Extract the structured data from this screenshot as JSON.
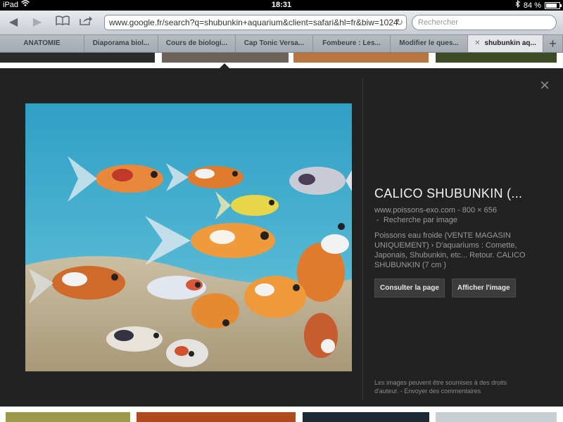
{
  "status": {
    "device": "iPad",
    "time": "18:31",
    "battery": "84 %",
    "battery_level": 0.84
  },
  "toolbar": {
    "url": "www.google.fr/search?q=shubunkin+aquarium&client=safari&hl=fr&biw=1024",
    "search_placeholder": "Rechercher"
  },
  "tabs": [
    {
      "label": "ANATOMIE"
    },
    {
      "label": "Diaporama biol..."
    },
    {
      "label": "Cours de biologi..."
    },
    {
      "label": "Cap Tonic Versa..."
    },
    {
      "label": "Fombeure : Les..."
    },
    {
      "label": "Modifier le ques..."
    },
    {
      "label": "shubunkin aq..."
    }
  ],
  "new_tab_label": "+",
  "detail": {
    "title": "CALICO SHUBUNKIN (...",
    "source": "www.poissons-exo.com",
    "dimensions": "800 × 656",
    "search_by_image": "Recherche par image",
    "description": "Poissons eau froide (VENTE MAGASIN UNIQUEMENT) › D'aquariums : Comette, Japonais, Shubunkin, etc... Retour. CALICO SHUBUNKIN (7 cm )",
    "visit_button": "Consulter la page",
    "view_button": "Afficher l'image",
    "rights_notice": "Les images peuvent être soumises à des droits d'auteur.",
    "feedback_link": "Envoyer des commentaires",
    "close_symbol": "×"
  },
  "colors": {
    "panel_bg": "#222222",
    "tank_water": "#3aa7c9",
    "tank_gravel": "#cfc2a8"
  }
}
